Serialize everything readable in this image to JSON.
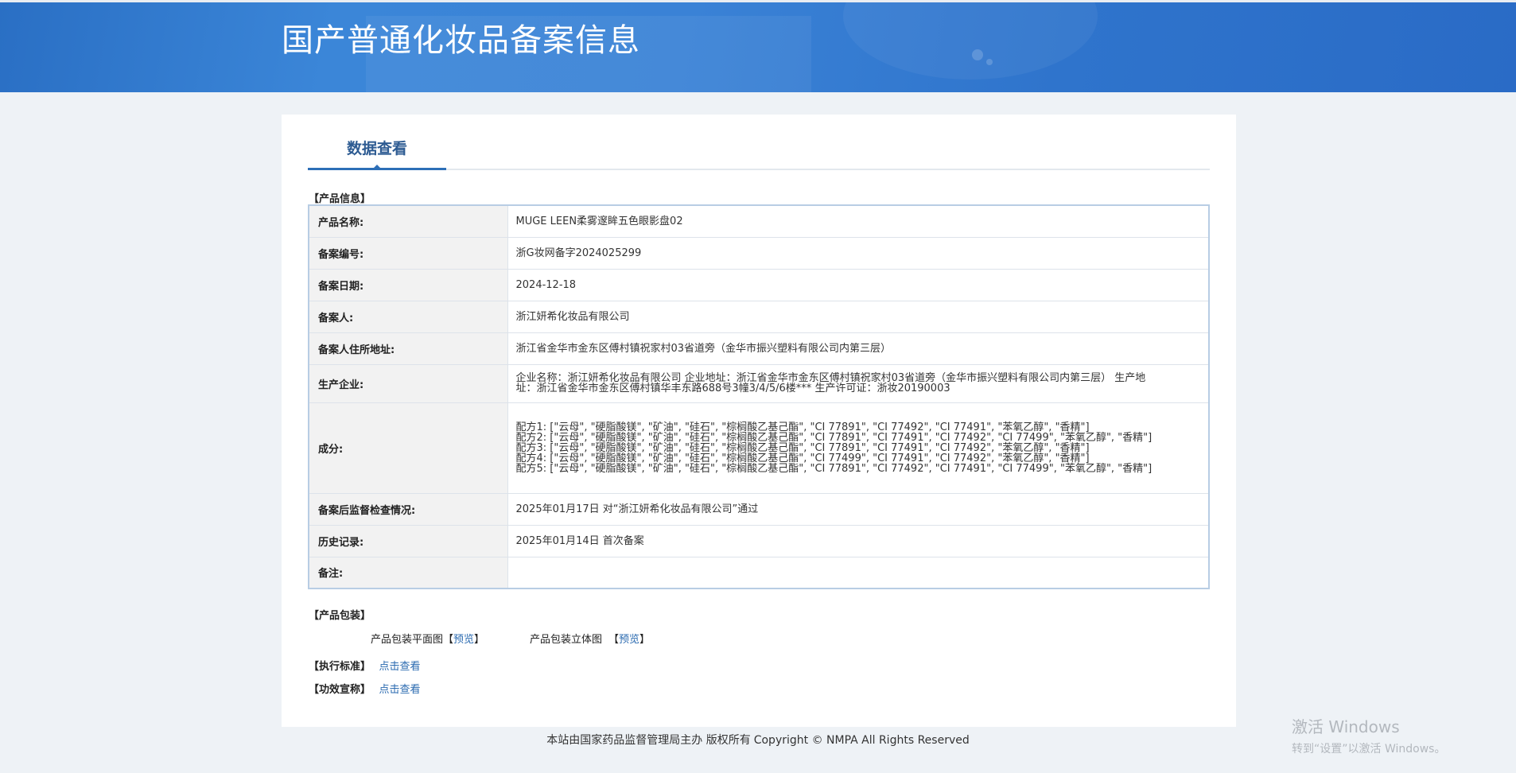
{
  "header": {
    "title": "国产普通化妆品备案信息"
  },
  "tab": {
    "label": "数据查看"
  },
  "sections": {
    "product_info": "【产品信息】",
    "packaging": "【产品包装】",
    "standard": "【执行标准】",
    "efficacy": "【功效宣称】"
  },
  "info_rows": [
    {
      "key": "产品名称:",
      "value": "MUGE LEEN柔雾邃眸五色眼影盘02"
    },
    {
      "key": "备案编号:",
      "value": "浙G妆网备字2024025299"
    },
    {
      "key": "备案日期:",
      "value": "2024-12-18"
    },
    {
      "key": "备案人:",
      "value": "浙江妍希化妆品有限公司"
    },
    {
      "key": "备案人住所地址:",
      "value": "浙江省金华市金东区傅村镇祝家村03省道旁（金华市振兴塑料有限公司内第三层）"
    },
    {
      "key": "生产企业:",
      "value": "企业名称：浙江妍希化妆品有限公司 企业地址：浙江省金华市金东区傅村镇祝家村03省道旁（金华市振兴塑料有限公司内第三层） 生产地址：浙江省金华市金东区傅村镇华丰东路688号3幢3/4/5/6楼*** 生产许可证：浙妆20190003"
    },
    {
      "key": "成分:",
      "value": "配方1: [\"云母\", \"硬脂酸镁\", \"矿油\", \"硅石\", \"棕榈酸乙基己酯\", \"CI 77891\", \"CI 77492\", \"CI 77491\", \"苯氧乙醇\", \"香精\"]\n配方2: [\"云母\", \"硬脂酸镁\", \"矿油\", \"硅石\", \"棕榈酸乙基己酯\", \"CI 77891\", \"CI 77491\", \"CI 77492\", \"CI 77499\", \"苯氧乙醇\", \"香精\"]\n配方3: [\"云母\", \"硬脂酸镁\", \"矿油\", \"硅石\", \"棕榈酸乙基己酯\", \"CI 77891\", \"CI 77491\", \"CI 77492\", \"苯氧乙醇\", \"香精\"]\n配方4: [\"云母\", \"硬脂酸镁\", \"矿油\", \"硅石\", \"棕榈酸乙基己酯\", \"CI 77499\", \"CI 77491\", \"CI 77492\", \"苯氧乙醇\", \"香精\"]\n配方5: [\"云母\", \"硬脂酸镁\", \"矿油\", \"硅石\", \"棕榈酸乙基己酯\", \"CI 77891\", \"CI 77492\", \"CI 77491\", \"CI 77499\", \"苯氧乙醇\", \"香精\"]"
    },
    {
      "key": "备案后监督检查情况:",
      "value": "2025年01月17日 对“浙江妍希化妆品有限公司”通过"
    },
    {
      "key": "历史记录:",
      "value": "2025年01月14日 首次备案"
    },
    {
      "key": "备注:",
      "value": ""
    }
  ],
  "packaging": {
    "flat_label": "产品包装平面图",
    "stereo_label": "产品包装立体图",
    "open_bracket": "【",
    "close_bracket": "】",
    "preview": "预览"
  },
  "click_view": "点击查看",
  "footer": {
    "sponsor": "本站由国家药品监督管理局主办 版权所有",
    "copyright": "Copyright © NMPA All Rights Reserved"
  },
  "watermark": {
    "line1": "激活 Windows",
    "line2": "转到“设置”以激活 Windows。"
  }
}
